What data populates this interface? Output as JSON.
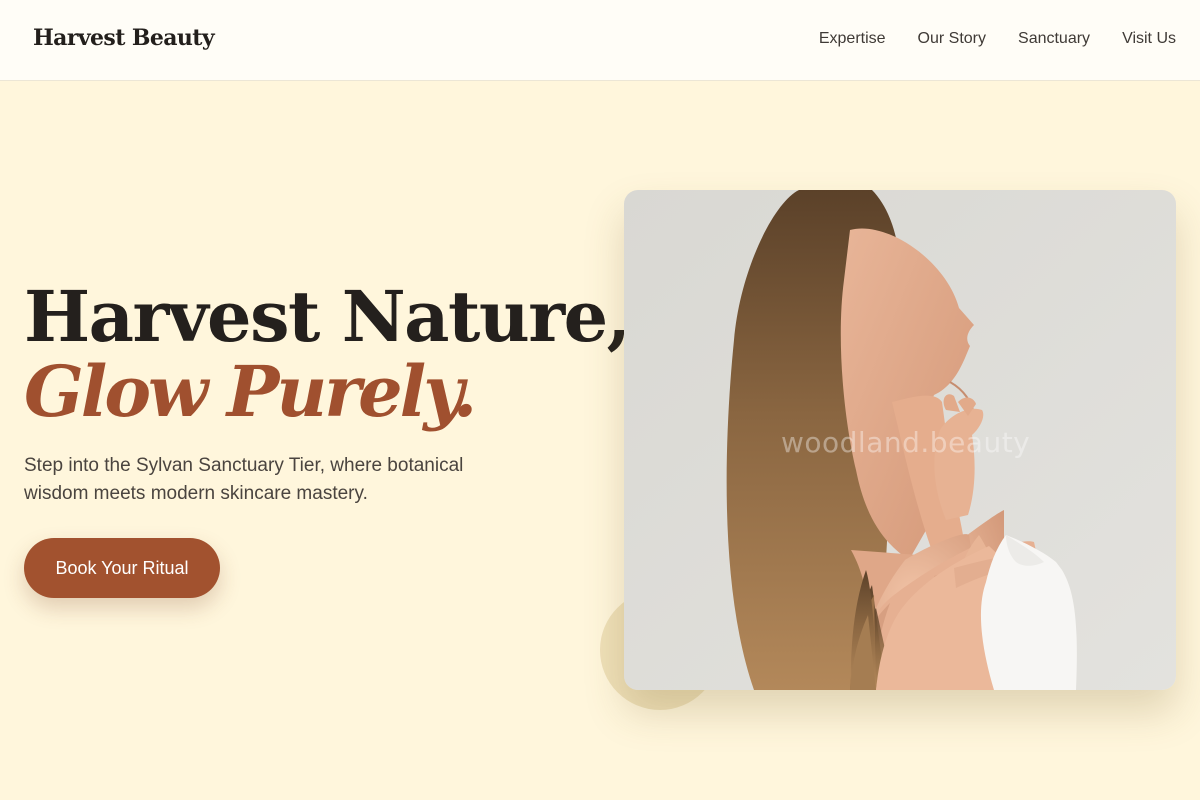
{
  "header": {
    "brand": "Harvest Beauty",
    "nav": [
      "Expertise",
      "Our Story",
      "Sanctuary",
      "Visit Us"
    ]
  },
  "hero": {
    "title": "Harvest Nature,",
    "accent": "Glow Purely.",
    "subtitle": "Step into the Sylvan Sanctuary Tier, where botanical wisdom meets modern skincare mastery.",
    "cta_label": "Book Your Ritual"
  },
  "image": {
    "watermark": "woodland.beauty"
  },
  "colors": {
    "background": "#fff6dc",
    "header_bg": "#fffdf7",
    "accent": "#a0502f",
    "button": "#a2522f",
    "text_dark": "#24201d"
  }
}
